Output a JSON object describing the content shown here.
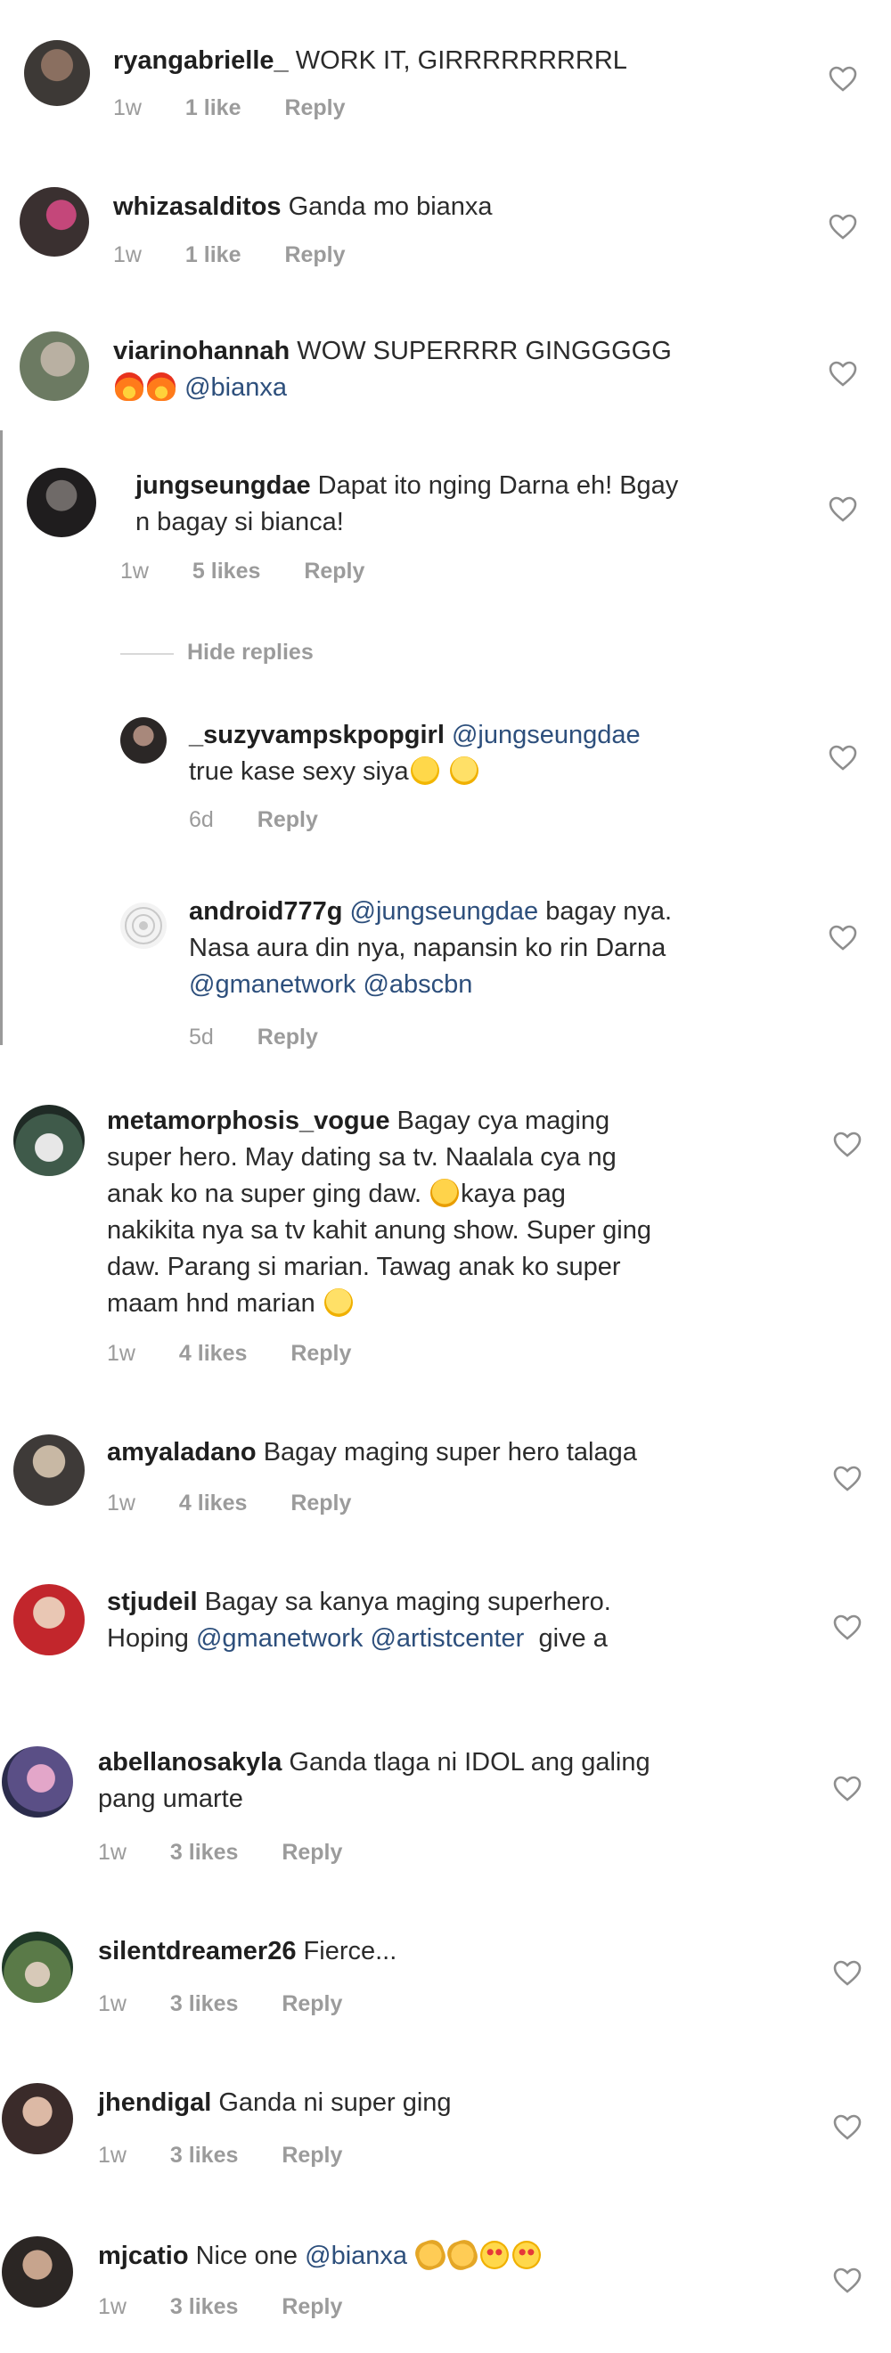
{
  "comments": [
    {
      "user": "ryangabrielle_",
      "text": "WORK IT, GIRRRRRRRRRL",
      "time": "1w",
      "likes": "1 like",
      "reply": "Reply"
    },
    {
      "user": "whizasalditos",
      "text": "Ganda mo bianxa",
      "time": "1w",
      "likes": "1 like",
      "reply": "Reply"
    },
    {
      "user": "viarinohannah",
      "text": "WOW SUPERRRR GINGGGGG",
      "mention": "@bianxa"
    },
    {
      "user": "jungseungdae",
      "text_line1": "Dapat ito nging Darna eh! Bgay",
      "text_line2": "n bagay si bianca!",
      "time": "1w",
      "likes": "5 likes",
      "reply": "Reply"
    },
    {
      "hide_replies": "Hide replies"
    },
    {
      "user": "_suzyvampskpopgirl",
      "mention": "@jungseungdae",
      "text_line2": "true kase sexy siya",
      "time": "6d",
      "reply": "Reply"
    },
    {
      "user": "android777g",
      "mention": "@jungseungdae",
      "text": "bagay nya.",
      "text_line2": "Nasa aura din nya, napansin ko rin Darna",
      "mention2": "@gmanetwork",
      "mention3": "@abscbn",
      "time": "5d",
      "reply": "Reply"
    },
    {
      "user": "metamorphosis_vogue",
      "text_line1": "Bagay cya maging",
      "text_line2": "super hero. May dating sa tv. Naalala cya ng",
      "text_line3": "anak ko na super ging daw.",
      "text_line3b": "kaya pag",
      "text_line4": "nakikita nya sa tv kahit anung show. Super ging",
      "text_line5": "daw. Parang si marian. Tawag anak ko super",
      "text_line6": "maam hnd marian",
      "time": "1w",
      "likes": "4 likes",
      "reply": "Reply"
    },
    {
      "user": "amyaladano",
      "text": "Bagay maging super hero talaga",
      "time": "1w",
      "likes": "4 likes",
      "reply": "Reply"
    },
    {
      "user": "stjudeil",
      "text_line1": "Bagay sa kanya maging superhero.",
      "text_line2": "Hoping",
      "mention": "@gmanetwork",
      "mention2": "@artistcenter",
      "text_line2b": "give a"
    },
    {
      "user": "abellanosakyla",
      "text_line1": "Ganda tlaga ni IDOL ang galing",
      "text_line2": "pang umarte",
      "time": "1w",
      "likes": "3 likes",
      "reply": "Reply"
    },
    {
      "user": "silentdreamer26",
      "text": "Fierce...",
      "time": "1w",
      "likes": "3 likes",
      "reply": "Reply"
    },
    {
      "user": "jhendigal",
      "text": "Ganda ni super ging",
      "time": "1w",
      "likes": "3 likes",
      "reply": "Reply"
    },
    {
      "user": "mjcatio",
      "text": "Nice one",
      "mention": "@bianxa",
      "time": "1w",
      "likes": "3 likes",
      "reply": "Reply"
    }
  ],
  "icons": {
    "like": "heart-outline-icon"
  },
  "colors": {
    "username": "#1f1f1f",
    "meta": "#9b9b9b",
    "mention": "#2d4f7c",
    "heart": "#8e8e8e"
  }
}
